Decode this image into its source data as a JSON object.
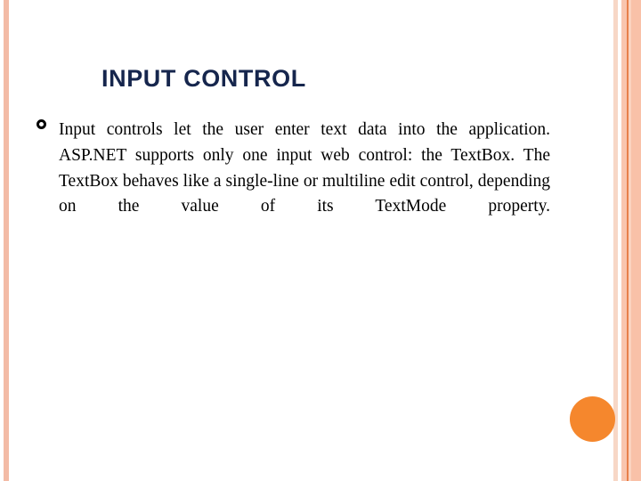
{
  "slide": {
    "title": "INPUT CONTROL",
    "title_color": "#16264d",
    "background_color": "#ffffff",
    "body": {
      "bullet_glyph": "hollow-ring",
      "text": "Input controls let the user enter text data into the application. ASP.NET supports only one input web control: the TextBox. The TextBox behaves like a single-line or multiline edit control, depending on the value of its TextMode property."
    },
    "decorations": {
      "left_stripe_color": "#f3bba6",
      "right_stripe_colors": [
        "#f7d7c6",
        "#ffffff",
        "#f9c5ae",
        "#e8804a",
        "#fbd3c0",
        "#f9c1a8"
      ],
      "accent_circle_color": "#f5872d"
    }
  }
}
